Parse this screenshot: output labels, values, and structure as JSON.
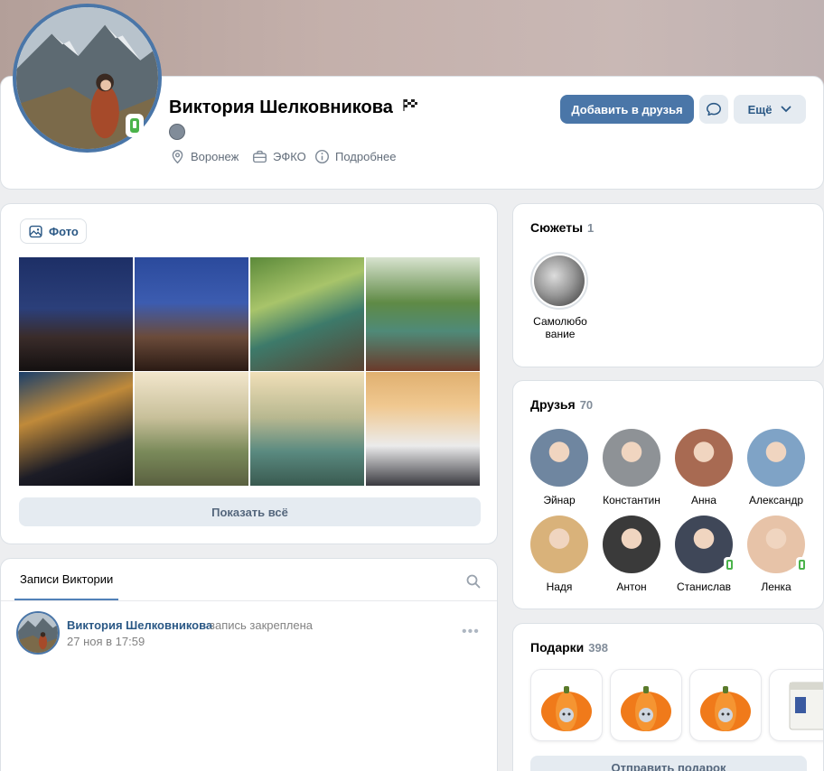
{
  "profile": {
    "name": "Виктория Шелковникова",
    "info": [
      {
        "icon": "location-icon",
        "label": "Воронеж"
      },
      {
        "icon": "briefcase-icon",
        "label": "ЭФКО"
      },
      {
        "icon": "info-icon",
        "label": "Подробнее"
      }
    ],
    "buttons": {
      "add_friend": "Добавить в друзья",
      "more": "Ещё"
    }
  },
  "photos": {
    "tab_label": "Фото",
    "show_all": "Показать всё",
    "count_shown": 8
  },
  "wall": {
    "tab_label": "Записи Виктории",
    "post": {
      "author": "Виктория Шелковникова",
      "action": "запись закреплена",
      "date": "27 ноя в 17:59"
    }
  },
  "stories": {
    "title": "Сюжеты",
    "count": "1",
    "items": [
      {
        "label": "Самолюбо\nвание"
      }
    ]
  },
  "friends": {
    "title": "Друзья",
    "count": "70",
    "items": [
      {
        "name": "Эйнар",
        "online": false,
        "color": "#6f86a0"
      },
      {
        "name": "Константин",
        "online": false,
        "color": "#8e9296"
      },
      {
        "name": "Анна",
        "online": false,
        "color": "#a86a52"
      },
      {
        "name": "Александр",
        "online": false,
        "color": "#7fa3c6"
      },
      {
        "name": "Надя",
        "online": false,
        "color": "#d9b27a"
      },
      {
        "name": "Антон",
        "online": false,
        "color": "#3a3a3a"
      },
      {
        "name": "Станислав",
        "online": true,
        "color": "#3f4758"
      },
      {
        "name": "Ленка",
        "online": true,
        "color": "#e7c3a8"
      }
    ]
  },
  "gifts": {
    "title": "Подарки",
    "count": "398",
    "send_label": "Отправить подарок"
  },
  "colors": {
    "accent": "#4a76a8",
    "link": "#2a5885",
    "online": "#4bb34b"
  }
}
